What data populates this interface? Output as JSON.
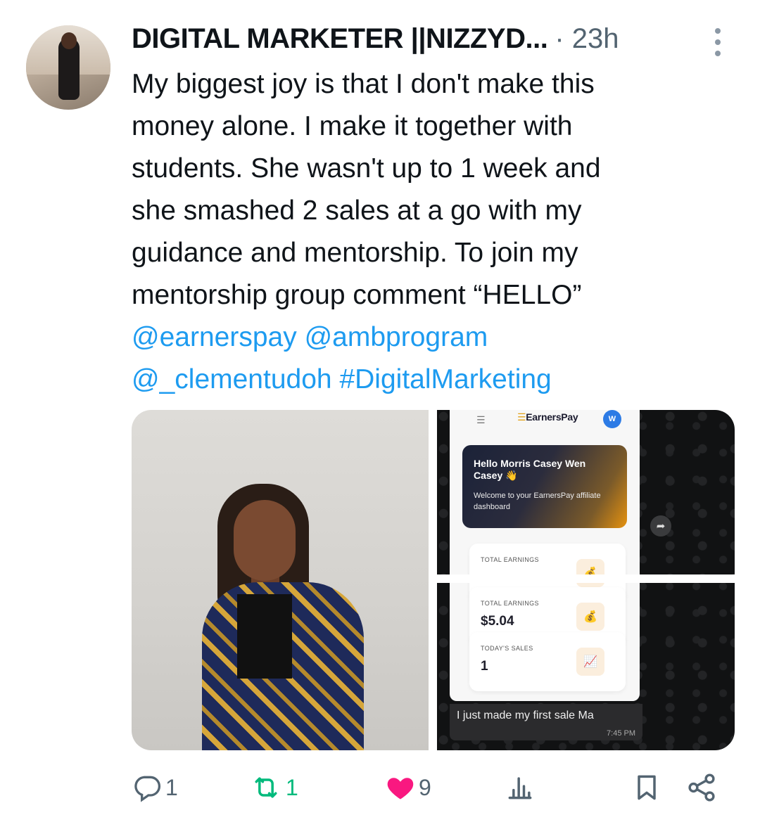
{
  "author": {
    "display_name": "DIGITAL MARKETER ||NIZZYD...",
    "time": "· 23h"
  },
  "tweet": {
    "lines": [
      "My biggest joy is that I don't make this",
      "money alone. I make it together with",
      "students. She wasn't up to 1 week and",
      "she smashed 2 sales at a go with my",
      "guidance and mentorship. To join my",
      "mentorship group comment “HELLO”"
    ],
    "mention_1": "@earnerspay",
    "mention_2": "@ambprogram",
    "mention_3": "@_clementudoh",
    "hashtag": "#DigitalMarketing"
  },
  "screenshot": {
    "brand": "EarnersPay",
    "brand_prefix": "☰",
    "avatar_letter": "W",
    "hello_title": "Hello Morris Casey Wen Casey 👋",
    "hello_sub": "Welcome to your EarnersPay affiliate dashboard",
    "card_1_label": "TOTAL EARNINGS",
    "card_2_label": "TOTAL EARNINGS",
    "card_2_value": "$5.04",
    "card_3_label": "TODAY'S SALES",
    "card_3_value": "1",
    "chat_message": "I just made my first sale Ma",
    "chat_time": "7:45 PM"
  },
  "actions": {
    "replies": "1",
    "retweets": "1",
    "likes": "9"
  },
  "colors": {
    "link": "#1d9bf0",
    "retweet": "#00ba7c",
    "like": "#f91880",
    "muted": "#536471"
  }
}
